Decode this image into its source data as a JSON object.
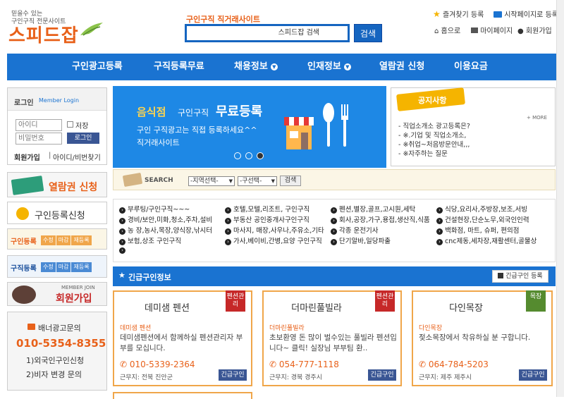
{
  "logo": {
    "tagline1": "믿을수 있는",
    "tagline2": "구인구직 전문사이트",
    "name": "스피드잡"
  },
  "search": {
    "caption": "구인구직 직거래사이트",
    "value": "스피드잡 검색",
    "button_label": "검색"
  },
  "toplinks": {
    "favorite": "즐겨찾기 등록",
    "startpage": "시작페이지로 등록",
    "home": "홈으로",
    "mypage": "마이페이지",
    "join": "회원가입"
  },
  "nav": {
    "items": [
      {
        "label": "구인광고등록",
        "dropdown": false
      },
      {
        "label": "구직등록무료",
        "dropdown": false
      },
      {
        "label": "채용정보",
        "dropdown": true
      },
      {
        "label": "인재정보",
        "dropdown": true
      },
      {
        "label": "열람권 신청",
        "dropdown": false
      },
      {
        "label": "이용요금",
        "dropdown": false
      }
    ]
  },
  "login": {
    "title": "로그인",
    "title_en": "Member Login",
    "id_placeholder": "아이디",
    "pw_placeholder": "비밀번호",
    "save_label": "저장",
    "login_button": "로그인",
    "join_link": "회원가입",
    "find_link": "아이디/비번찾기"
  },
  "side": {
    "browse_label": "열람권 신청",
    "register_label": "구인등록신청",
    "job_reg": {
      "label": "구인등록",
      "buttons": [
        "수정",
        "마감",
        "재등록"
      ]
    },
    "seek_reg": {
      "label": "구직등록",
      "buttons": [
        "수정",
        "마감",
        "재등록"
      ]
    },
    "member_join_en": "MEMBER JOIN",
    "member_join": "회원가입",
    "ad_title": "배너광고문의",
    "ad_phone": "010-5354-8355",
    "ad_line1": "1)외국인구인신청",
    "ad_line2": "2)비자 변경 문의"
  },
  "hero": {
    "line1_a": "음식점",
    "line1_b": "구인구직",
    "line1_c": "무료등록",
    "line2": "구인 구직광고는 직접 등록하세요^^",
    "line3": "직거래사이트"
  },
  "notice": {
    "title": "공지사항",
    "more": "+ MORE",
    "items": [
      "직업소개소 광고등록은?",
      "※.기업 및 직업소개소,",
      "※취업~처음방문안내,,,",
      "※자주하는 질문"
    ]
  },
  "searchbar": {
    "label": "SEARCH",
    "region": "-지역선택-",
    "district": "-구선택-",
    "button": "검색"
  },
  "categories": [
    [
      "부루팅/구인구직~~~",
      "호텔,모텔,리조트, 구인구직",
      "펜션,별장,골프,고시원,세탁",
      "식당,요리사,주방장,보조,서빙"
    ],
    [
      "경비/보안,미화,청소,주차,설비",
      "부동산 공인중개사구인구직",
      "회사,공장,가구,용접,생산직,식품",
      "건설현장,단순노무,외국인인력"
    ],
    [
      "농 장,농사,목장,양식장,낚시터",
      "마사지, 매장,사우나,주유소,기타",
      "각종 운전기사",
      "백화점, 마트, 슈퍼, 편의점"
    ],
    [
      "보험,상조 구인구직",
      "가사,베이비,간병,요양 구인구직",
      "단기알바,일당파출",
      "cnc제동,세차장,재활센터,골물상"
    ]
  ],
  "urgent": {
    "title": "긴급구인정보",
    "register_button": "긴급구인 등록"
  },
  "cards": [
    {
      "title": "데미샘 펜션",
      "tag": "펜션관리",
      "sub": "데미샘 펜션",
      "desc": "데미샘펜션에서 함께하실 펜션관리자 부부를 모십니다.",
      "phone": "010-5339-2364",
      "area": "근무지: 전북 진안군",
      "button": "긴급구인",
      "tag_color": "#c62828"
    },
    {
      "title": "더마린풀빌라",
      "tag": "펜션관리",
      "sub": "더마린풀빌라",
      "desc": "초보환영 돈 많이 벌수있는 풀빌라 펜션입니다~ 클릭! 실장님 부부팀 환..",
      "phone": "054-777-1118",
      "area": "근무지: 경북 경주시",
      "button": "긴급구인",
      "tag_color": "#c62828"
    },
    {
      "title": "다인목장",
      "tag": "목장",
      "sub": "다인목장",
      "desc": "젖소목장에서 착유하실 분 구합니다.",
      "phone": "064-784-5203",
      "area": "근무지: 제주 제주시",
      "button": "긴급구인",
      "tag_color": "#558b2f"
    }
  ],
  "colors": {
    "primary": "#1a73d1",
    "accent": "#e8611a",
    "card_border": "#f0a64a"
  }
}
